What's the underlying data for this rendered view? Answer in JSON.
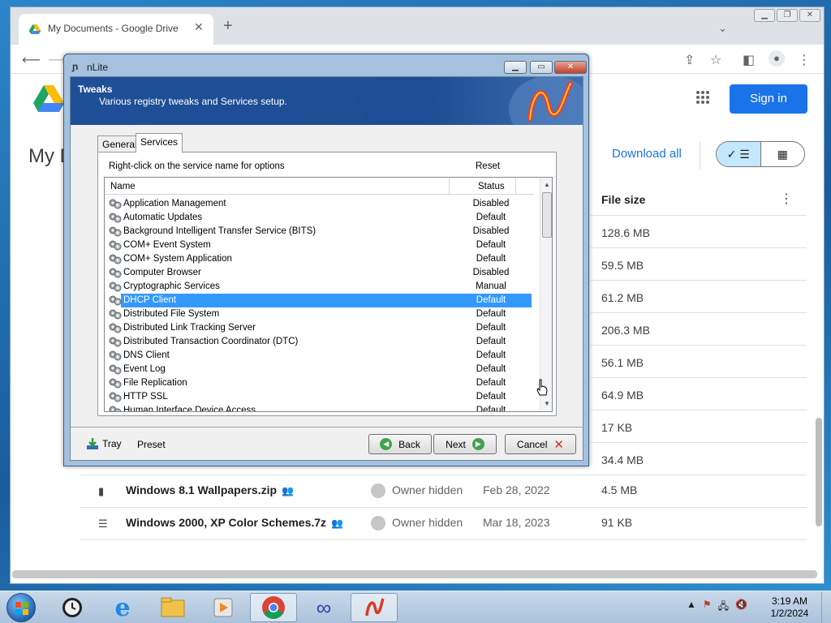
{
  "browser": {
    "tab_title": "My Documents - Google Drive",
    "tab_close": "✕",
    "new_tab": "+"
  },
  "drive": {
    "page_title": "My D",
    "sign_in": "Sign in",
    "download_all": "Download all",
    "file_size_header": "File size",
    "partial_sizes": [
      "128.6 MB",
      "59.5 MB",
      "61.2 MB",
      "206.3 MB",
      "56.1 MB",
      "64.9 MB",
      "17 KB",
      "34.4 MB"
    ],
    "rows": [
      {
        "name": "Windows 8.1 Wallpapers.zip",
        "owner": "Owner hidden",
        "date": "Feb 28, 2022",
        "size": "4.5 MB"
      },
      {
        "name": "Windows 2000, XP Color Schemes.7z",
        "owner": "Owner hidden",
        "date": "Mar 18, 2023",
        "size": "91 KB"
      }
    ]
  },
  "nlite": {
    "window_title": "nLite",
    "header_title": "Tweaks",
    "header_subtitle": "Various registry tweaks and Services setup.",
    "tabs": [
      "General",
      "Services"
    ],
    "active_tab": "Services",
    "hint": "Right-click on the service name for options",
    "reset": "Reset",
    "columns": {
      "name": "Name",
      "status": "Status"
    },
    "services": [
      {
        "name": "Application Management",
        "status": "Disabled"
      },
      {
        "name": "Automatic Updates",
        "status": "Default"
      },
      {
        "name": "Background Intelligent Transfer Service (BITS)",
        "status": "Disabled"
      },
      {
        "name": "COM+ Event System",
        "status": "Default"
      },
      {
        "name": "COM+ System Application",
        "status": "Default"
      },
      {
        "name": "Computer Browser",
        "status": "Disabled"
      },
      {
        "name": "Cryptographic Services",
        "status": "Manual"
      },
      {
        "name": "DHCP Client",
        "status": "Default"
      },
      {
        "name": "Distributed File System",
        "status": "Default"
      },
      {
        "name": "Distributed Link Tracking Server",
        "status": "Default"
      },
      {
        "name": "Distributed Transaction Coordinator (DTC)",
        "status": "Default"
      },
      {
        "name": "DNS Client",
        "status": "Default"
      },
      {
        "name": "Event Log",
        "status": "Default"
      },
      {
        "name": "File Replication",
        "status": "Default"
      },
      {
        "name": "HTTP SSL",
        "status": "Default"
      },
      {
        "name": "Human Interface Device Access",
        "status": "Default"
      }
    ],
    "selected_service": "DHCP Client",
    "footer": {
      "tray": "Tray",
      "preset": "Preset",
      "back": "Back",
      "next": "Next",
      "cancel": "Cancel"
    }
  },
  "taskbar": {
    "time": "3:19 AM",
    "date": "1/2/2024",
    "apps": [
      "clock-app-icon",
      "internet-explorer-icon",
      "file-explorer-icon",
      "media-player-icon",
      "chrome-icon",
      "infinity-app-icon",
      "nlite-icon"
    ]
  },
  "colors": {
    "accent_blue": "#1a73e8",
    "nlite_header": "#1f4f96",
    "selection": "#3399ff"
  }
}
